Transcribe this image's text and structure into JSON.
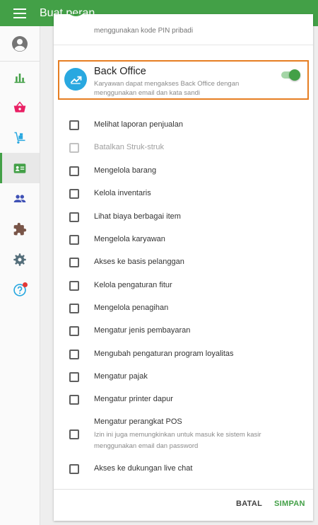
{
  "appbar": {
    "title": "Buat peran",
    "menu_icon": "hamburger-menu-icon"
  },
  "sidebar": {
    "items": [
      {
        "name": "profile",
        "icon": "account-circle-icon",
        "color": "#757575"
      },
      {
        "name": "reports",
        "icon": "bar-chart-icon",
        "color": "#43a047"
      },
      {
        "name": "items",
        "icon": "shopping-basket-icon",
        "color": "#e91e63"
      },
      {
        "name": "inventory",
        "icon": "hand-truck-icon",
        "color": "#29a8e0"
      },
      {
        "name": "employees",
        "icon": "badge-card-icon",
        "color": "#43a047",
        "active": true
      },
      {
        "name": "customers",
        "icon": "people-icon",
        "color": "#3f51b5"
      },
      {
        "name": "integrations",
        "icon": "puzzle-icon",
        "color": "#795548"
      },
      {
        "name": "settings",
        "icon": "gear-icon",
        "color": "#546e7a"
      },
      {
        "name": "help",
        "icon": "help-circle-icon",
        "color": "#29a8e0",
        "badge": true
      }
    ]
  },
  "card": {
    "prev_section_text": "menggunakan kode PIN pribadi",
    "back_office": {
      "title": "Back Office",
      "description": "Karyawan dapat mengakses Back Office dengan menggunakan email dan kata sandi",
      "enabled": true,
      "icon": "trending-up-icon"
    },
    "permissions": [
      {
        "label": "Melihat laporan penjualan",
        "checked": false,
        "disabled": false
      },
      {
        "label": "Batalkan Struk-struk",
        "checked": false,
        "disabled": true
      },
      {
        "label": "Mengelola barang",
        "checked": false,
        "disabled": false
      },
      {
        "label": "Kelola inventaris",
        "checked": false,
        "disabled": false
      },
      {
        "label": "Lihat biaya berbagai item",
        "checked": false,
        "disabled": false
      },
      {
        "label": "Mengelola karyawan",
        "checked": false,
        "disabled": false
      },
      {
        "label": "Akses ke basis pelanggan",
        "checked": false,
        "disabled": false
      },
      {
        "label": "Kelola pengaturan fitur",
        "checked": false,
        "disabled": false
      },
      {
        "label": "Mengelola penagihan",
        "checked": false,
        "disabled": false
      },
      {
        "label": "Mengatur jenis pembayaran",
        "checked": false,
        "disabled": false
      },
      {
        "label": "Mengubah pengaturan program loyalitas",
        "checked": false,
        "disabled": false
      },
      {
        "label": "Mengatur pajak",
        "checked": false,
        "disabled": false
      },
      {
        "label": "Mengatur printer dapur",
        "checked": false,
        "disabled": false
      },
      {
        "label": "Mengatur perangkat POS",
        "checked": false,
        "disabled": false,
        "sub": "Izin ini juga memungkinkan untuk masuk ke sistem kasir menggunakan email dan password"
      },
      {
        "label": "Akses ke dukungan live chat",
        "checked": false,
        "disabled": false
      }
    ]
  },
  "footer": {
    "cancel_label": "BATAL",
    "save_label": "SIMPAN"
  },
  "colors": {
    "primary": "#43a047",
    "highlight_border": "#e67e22",
    "back_office_icon": "#29a8e0"
  }
}
